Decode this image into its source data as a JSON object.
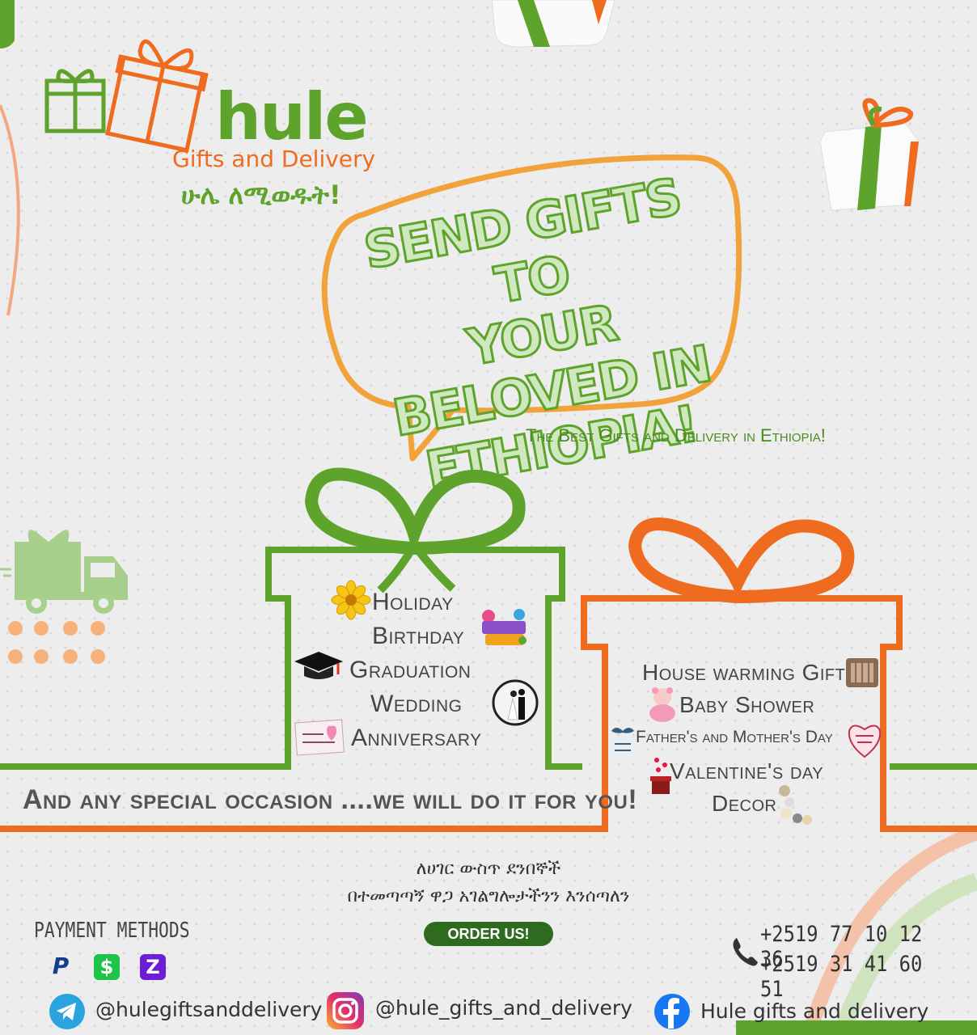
{
  "brand": {
    "name": "hule",
    "subtitle": "Gifts and Delivery",
    "amharic_tagline": "ሁሌ ለሚወዱት!"
  },
  "headline": {
    "line1": "SEND GIFTS TO",
    "line2": "YOUR BELOVED IN",
    "line3": "ETHIOPIA!"
  },
  "subheadline": "The Best Gifts and Delivery in Ethiopia!",
  "green_box": {
    "items": [
      "Holiday",
      "Birthday",
      "Graduation",
      "Wedding",
      "Anniversary"
    ]
  },
  "orange_box": {
    "items": [
      "House warming Gift",
      "Baby Shower",
      "Father's and Mother's Day",
      "Valentine's day",
      "Decor"
    ]
  },
  "special_occasion": "And any special occasion ....we will do it for you!",
  "amharic_lines": {
    "line1": "ለሀገር ውስጥ ደንበኞች",
    "line2": "በተመጣጣኝ ዋጋ አገልግሎታችንን እንሰጣለን"
  },
  "order_button": "ORDER US!",
  "payment": {
    "title": "PAYMENT METHODS",
    "icons": [
      "paypal-icon",
      "cash-app-icon",
      "zelle-icon"
    ],
    "paypal_glyph": "P",
    "cashapp_glyph": "$",
    "zelle_glyph": "Z"
  },
  "phones": [
    "+2519 77 10 12 36",
    "+2519 31 41 60 51"
  ],
  "social": {
    "telegram": "@hulegiftsanddelivery",
    "instagram": "@hule_gifts_and_delivery",
    "facebook": "Hule gifts and delivery"
  },
  "colors": {
    "green": "#5ea32c",
    "orange": "#ef6b1f",
    "headline_stroke": "#5ea32c",
    "button": "#2e6b1f"
  }
}
